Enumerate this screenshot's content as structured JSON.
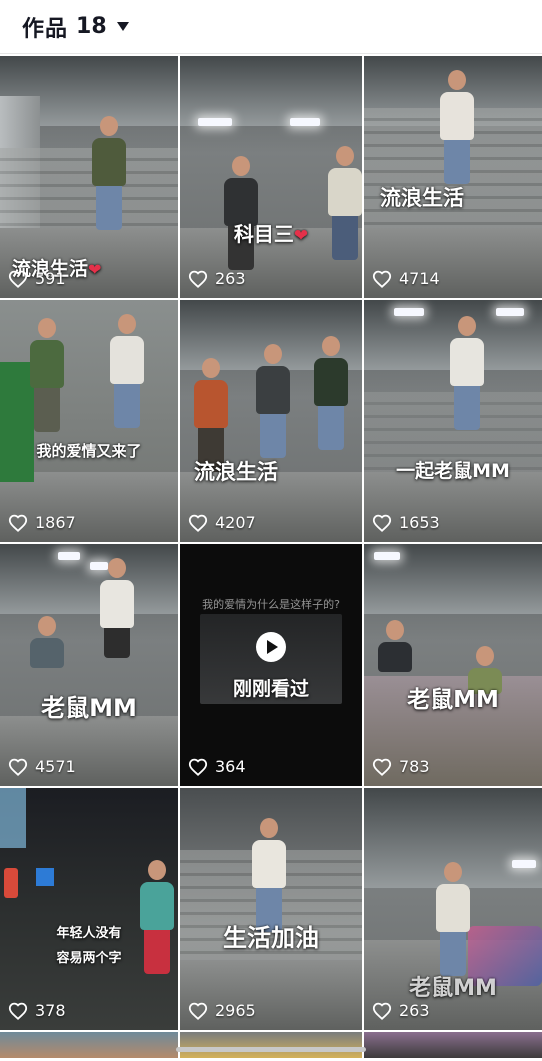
{
  "header": {
    "title": "作品",
    "count": "18"
  },
  "colors": {
    "heart_red": "#e5314a",
    "text_dark": "#161823"
  },
  "icons": {
    "like": "heart-outline-icon",
    "dropdown": "caret-down-icon",
    "play": "play-icon"
  },
  "tiles": [
    {
      "caption": "流浪生活",
      "caption_heart": "❤",
      "likes": "591"
    },
    {
      "caption": "科目三",
      "caption_heart": "❤",
      "likes": "263"
    },
    {
      "caption": "流浪生活",
      "caption_heart": "",
      "likes": "4714"
    },
    {
      "caption": "我的爱情又来了",
      "caption_heart": "",
      "likes": "1867"
    },
    {
      "caption": "流浪生活",
      "caption_heart": "",
      "likes": "4207"
    },
    {
      "caption": "一起老鼠MM",
      "caption_heart": "",
      "likes": "1653"
    },
    {
      "caption": "老鼠MM",
      "caption_heart": "",
      "likes": "4571"
    },
    {
      "caption": "刚刚看过",
      "caption_heart": "",
      "likes": "364",
      "overlay_top": "我的爱情为什么是这样子的?"
    },
    {
      "caption": "老鼠MM",
      "caption_heart": "",
      "likes": "783"
    },
    {
      "caption_line1": "年轻人没有",
      "caption_line2": "容易两个字",
      "likes": "378"
    },
    {
      "caption": "生活加油",
      "caption_heart": "",
      "likes": "2965"
    },
    {
      "caption": "老鼠MM",
      "caption_heart": "",
      "likes": "263"
    }
  ]
}
